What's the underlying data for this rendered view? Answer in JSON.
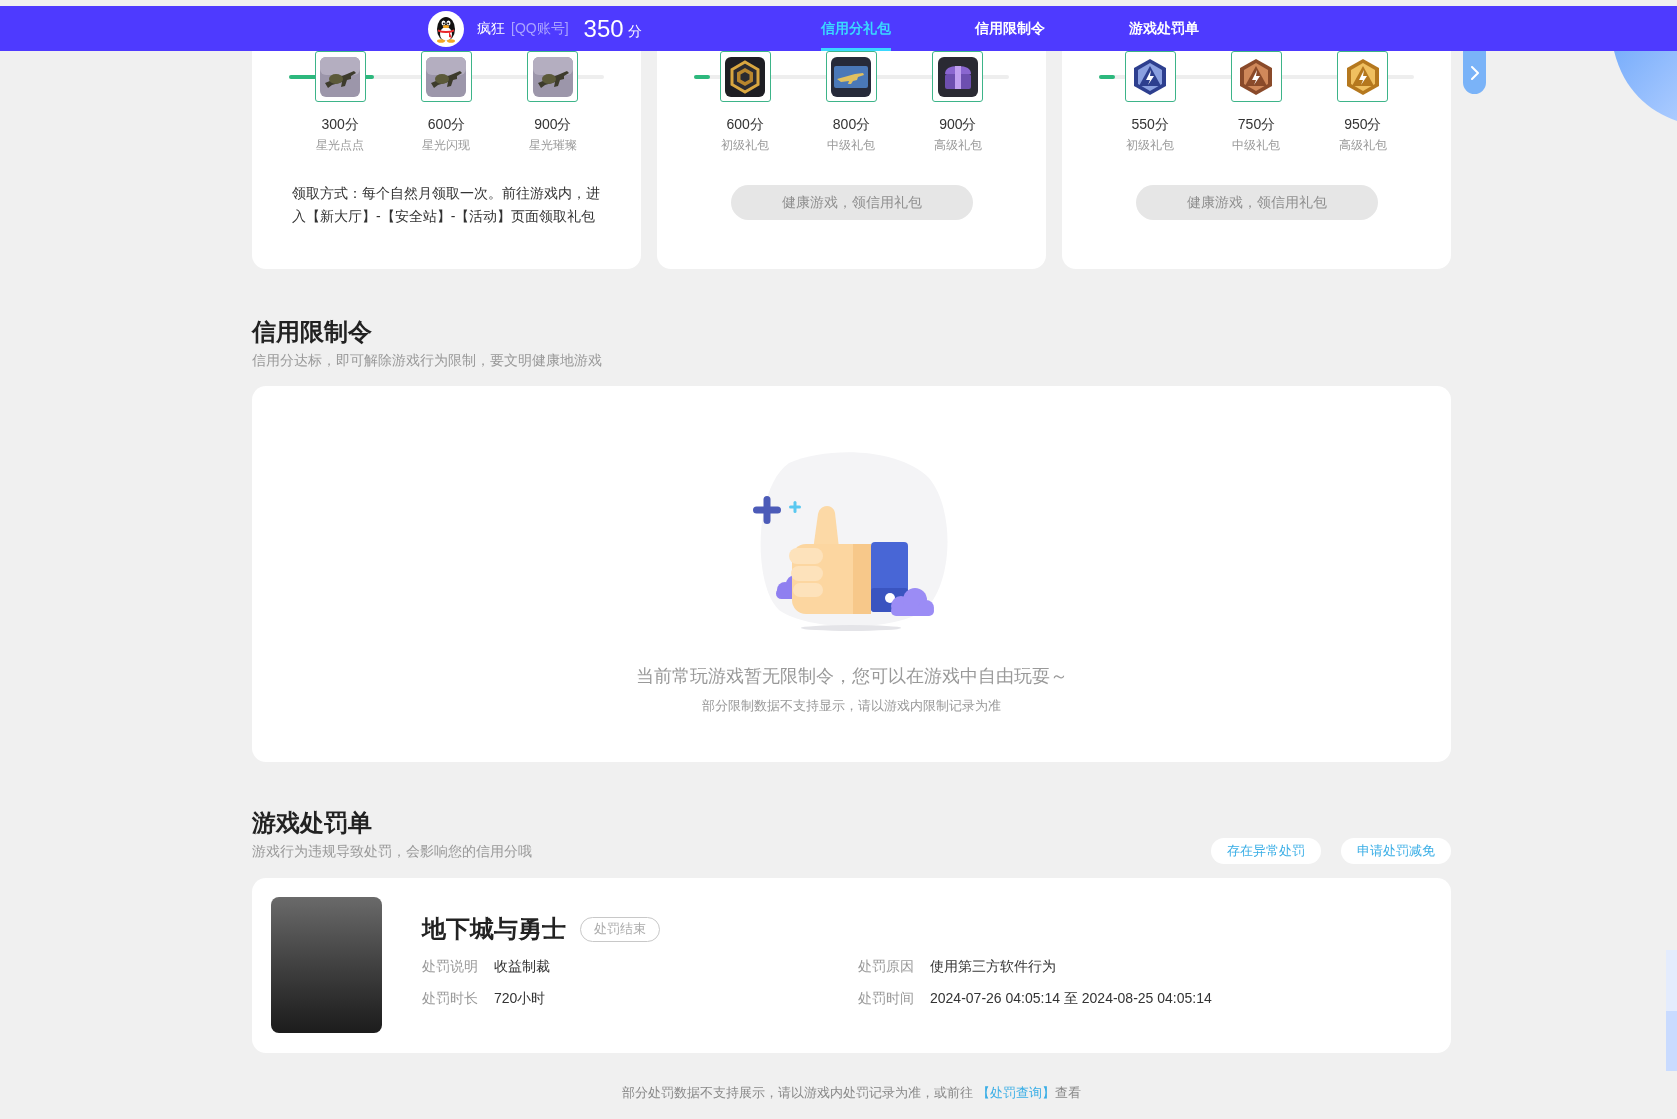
{
  "nav": {
    "user": {
      "name": "疯狂",
      "account": "[QQ账号]",
      "score": "350",
      "score_unit": "分"
    },
    "tabs": [
      {
        "label": "信用分礼包",
        "selected": true
      },
      {
        "label": "信用限制令",
        "selected": false
      },
      {
        "label": "游戏处罚单",
        "selected": false
      }
    ]
  },
  "gift_cards": [
    {
      "kind": "note",
      "level": 0.27,
      "rewards": [
        {
          "points": "300分",
          "name": "星光点点"
        },
        {
          "points": "600分",
          "name": "星光闪现"
        },
        {
          "points": "900分",
          "name": "星光璀璨"
        }
      ],
      "note": "领取方式：每个自然月领取一次。前往游戏内，进入【新大厅】-【安全站】-【活动】页面领取礼包"
    },
    {
      "kind": "button",
      "level": 0.05,
      "rewards": [
        {
          "points": "600分",
          "name": "初级礼包"
        },
        {
          "points": "800分",
          "name": "中级礼包"
        },
        {
          "points": "900分",
          "name": "高级礼包"
        }
      ],
      "button": {
        "label": "健康游戏，领信用礼包",
        "disabled": true
      }
    },
    {
      "kind": "button",
      "level": 0.05,
      "rewards": [
        {
          "points": "550分",
          "name": "初级礼包"
        },
        {
          "points": "750分",
          "name": "中级礼包"
        },
        {
          "points": "950分",
          "name": "高级礼包"
        }
      ],
      "button": {
        "label": "健康游戏，领信用礼包",
        "disabled": true
      }
    }
  ],
  "restrictions": {
    "title": "信用限制令",
    "subtitle": "信用分达标，即可解除游戏行为限制，要文明健康地游戏",
    "empty_message": "当前常玩游戏暂无限制令，您可以在游戏中自由玩耍～",
    "empty_note": "部分限制数据不支持显示，请以游戏内限制记录为准"
  },
  "penalties": {
    "title": "游戏处罚单",
    "subtitle": "游戏行为违规导致处罚，会影响您的信用分哦",
    "actions": [
      "存在异常处罚",
      "申请处罚减免"
    ],
    "items": [
      {
        "game": "地下城与勇士",
        "status": "处罚结束",
        "fields": [
          {
            "label": "处罚说明",
            "value": "收益制裁"
          },
          {
            "label": "处罚原因",
            "value": "使用第三方软件行为"
          },
          {
            "label": "处罚时长",
            "value": "720小时"
          },
          {
            "label": "处罚时间",
            "value": "2024-07-26 04:05:14 至 2024-08-25 04:05:14"
          }
        ]
      }
    ],
    "footer": {
      "text": "部分处罚数据不支持展示，请以游戏内处罚记录为准，或前往",
      "link": "【处罚查询】",
      "after": "查看"
    }
  }
}
